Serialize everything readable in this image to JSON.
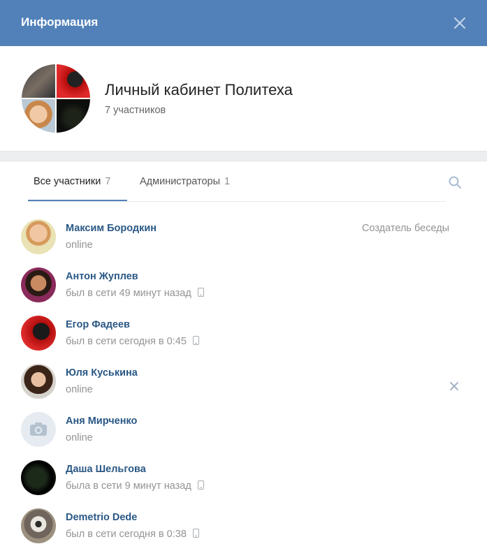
{
  "header": {
    "title": "Информация",
    "close_icon": "close-icon",
    "background": "#5181b8"
  },
  "chat": {
    "title": "Личный кабинет Политеха",
    "members_count": "7 участников"
  },
  "tabs": [
    {
      "label": "Все участники",
      "count": "7",
      "active": true
    },
    {
      "label": "Администраторы",
      "count": "1",
      "active": false
    }
  ],
  "search_icon": "search-icon",
  "members": [
    {
      "name": "Максим Бородкин",
      "status": "online",
      "role": "Создатель беседы",
      "mobile": false
    },
    {
      "name": "Антон Жуплев",
      "status": "был в сети 49 минут назад",
      "mobile": true
    },
    {
      "name": "Егор Фадеев",
      "status": "был в сети сегодня в 0:45",
      "mobile": true
    },
    {
      "name": "Юля Куськина",
      "status": "online",
      "mobile": false,
      "removable": true
    },
    {
      "name": "Аня Мирченко",
      "status": "online",
      "mobile": false,
      "no_photo": true
    },
    {
      "name": "Даша Шельгова",
      "status": "была в сети 9 минут назад",
      "mobile": true
    },
    {
      "name": "Demetrio Dede",
      "status": "был в сети сегодня в 0:38",
      "mobile": true
    }
  ],
  "colors": {
    "accent": "#5181b8",
    "link": "#2a5885",
    "muted": "#939393"
  }
}
